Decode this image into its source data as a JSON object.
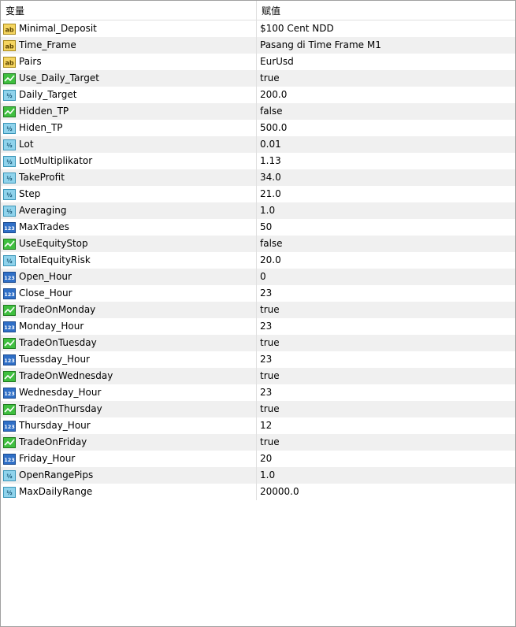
{
  "header": {
    "name_label": "变量",
    "value_label": "赋值"
  },
  "rows": [
    {
      "name": "Minimal_Deposit",
      "value": "$100 Cent NDD",
      "icon": "ab"
    },
    {
      "name": "Time_Frame",
      "value": "Pasang di Time Frame M1",
      "icon": "ab"
    },
    {
      "name": "Pairs",
      "value": "EurUsd",
      "icon": "ab"
    },
    {
      "name": "Use_Daily_Target",
      "value": "true",
      "icon": "bool"
    },
    {
      "name": "Daily_Target",
      "value": "200.0",
      "icon": "double"
    },
    {
      "name": "Hidden_TP",
      "value": "false",
      "icon": "bool"
    },
    {
      "name": "Hiden_TP",
      "value": "500.0",
      "icon": "double"
    },
    {
      "name": "Lot",
      "value": "0.01",
      "icon": "double"
    },
    {
      "name": "LotMultiplikator",
      "value": "1.13",
      "icon": "double"
    },
    {
      "name": "TakeProfit",
      "value": "34.0",
      "icon": "double"
    },
    {
      "name": "Step",
      "value": "21.0",
      "icon": "double"
    },
    {
      "name": "Averaging",
      "value": "1.0",
      "icon": "double"
    },
    {
      "name": "MaxTrades",
      "value": "50",
      "icon": "int"
    },
    {
      "name": "UseEquityStop",
      "value": "false",
      "icon": "bool"
    },
    {
      "name": "TotalEquityRisk",
      "value": "20.0",
      "icon": "double"
    },
    {
      "name": "Open_Hour",
      "value": "0",
      "icon": "int"
    },
    {
      "name": "Close_Hour",
      "value": "23",
      "icon": "int"
    },
    {
      "name": "TradeOnMonday",
      "value": "true",
      "icon": "bool"
    },
    {
      "name": "Monday_Hour",
      "value": "23",
      "icon": "int"
    },
    {
      "name": "TradeOnTuesday",
      "value": "true",
      "icon": "bool"
    },
    {
      "name": "Tuessday_Hour",
      "value": "23",
      "icon": "int"
    },
    {
      "name": "TradeOnWednesday",
      "value": "true",
      "icon": "bool"
    },
    {
      "name": "Wednesday_Hour",
      "value": "23",
      "icon": "int"
    },
    {
      "name": "TradeOnThursday",
      "value": "true",
      "icon": "bool"
    },
    {
      "name": "Thursday_Hour",
      "value": "12",
      "icon": "int"
    },
    {
      "name": "TradeOnFriday",
      "value": "true",
      "icon": "bool"
    },
    {
      "name": "Friday_Hour",
      "value": "20",
      "icon": "int"
    },
    {
      "name": "OpenRangePips",
      "value": "1.0",
      "icon": "double"
    },
    {
      "name": "MaxDailyRange",
      "value": "20000.0",
      "icon": "double"
    }
  ],
  "colors": {
    "row_alt": "#f0f0f0",
    "grid": "#e0e0e0",
    "icon_ab_fill": "#f5d560",
    "icon_bool_fill": "#3fbf3f",
    "icon_double_fill": "#8fd3ec",
    "icon_int_fill": "#2f6fc7"
  }
}
